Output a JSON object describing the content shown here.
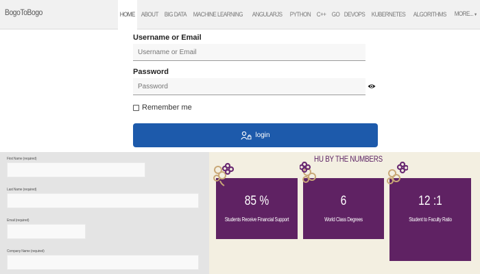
{
  "navbar": {
    "brand": "BogoToBogo",
    "items": [
      {
        "label": "HOME",
        "active": true
      },
      {
        "label": "ABOUT"
      },
      {
        "label": "BIG DATA"
      },
      {
        "label": "MACHINE LEARNING"
      },
      {
        "label": "ANGULARJS"
      },
      {
        "label": "PYTHON"
      },
      {
        "label": "C++"
      },
      {
        "label": "GO"
      },
      {
        "label": "DEVOPS"
      },
      {
        "label": "KUBERNETES"
      },
      {
        "label": "ALGORITHMS"
      },
      {
        "label": "MORE..."
      }
    ],
    "more_caret_icon": "caret-down-icon"
  },
  "login": {
    "username_label": "Username or Email",
    "username_placeholder": "Username or Email",
    "password_label": "Password",
    "password_placeholder": "Password",
    "show_password_icon": "eye-icon",
    "remember_label": "Remember me",
    "remember_checked": false,
    "button_label": "login",
    "button_icon": "user-lock-icon",
    "button_color": "#1d5aab"
  },
  "mini_form": {
    "fields": [
      {
        "label": "First Name (required)"
      },
      {
        "label": "Last Name (required)"
      },
      {
        "label": "Email (required)"
      },
      {
        "label": "Company Name (required)"
      }
    ]
  },
  "numbers": {
    "title": "HU BY THE NUMBERS",
    "accent": "#5f2263",
    "background": "#f3efe1",
    "stats": [
      {
        "value": "85 %",
        "label": "Students Receive Financial Support"
      },
      {
        "value": "6",
        "label": "World Class Degrees"
      },
      {
        "value": "12 :1",
        "label": "Student to Faculty Ratio"
      }
    ]
  }
}
